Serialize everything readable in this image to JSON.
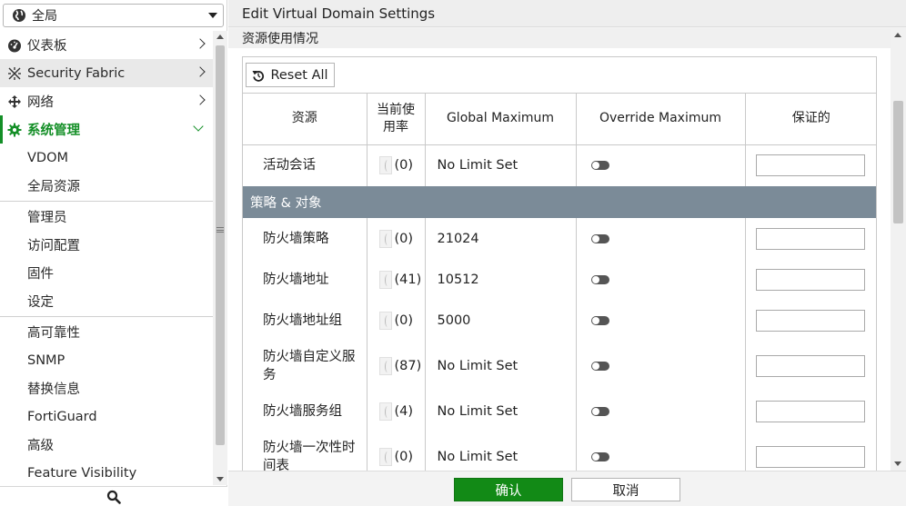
{
  "vdom_selector": {
    "value": "全局",
    "icon": "globe-icon"
  },
  "nav": {
    "dashboard": {
      "label": "仪表板",
      "icon": "dashboard-icon"
    },
    "security_fabric": {
      "label": "Security Fabric",
      "icon": "fabric-icon"
    },
    "network": {
      "label": "网络",
      "icon": "network-icon"
    },
    "system": {
      "label": "系统管理",
      "icon": "gear-icon"
    },
    "system_items": [
      "VDOM",
      "全局资源",
      "管理员",
      "访问配置",
      "固件",
      "设定",
      "高可靠性",
      "SNMP",
      "替换信息",
      "FortiGuard",
      "高级",
      "Feature Visibility"
    ]
  },
  "main": {
    "title": "Edit Virtual Domain Settings",
    "section": "资源使用情况",
    "reset_label": "Reset All",
    "columns": [
      "资源",
      "当前使用率",
      "Global Maximum",
      "Override Maximum",
      "保证的"
    ],
    "rows_top": [
      {
        "name": "活动会话",
        "usage": "(0)",
        "gmax": "No Limit Set"
      }
    ],
    "group_label": "策略 & 对象",
    "rows_group": [
      {
        "name": "防火墙策略",
        "usage": "(0)",
        "gmax": "21024"
      },
      {
        "name": "防火墙地址",
        "usage": "(41)",
        "gmax": "10512"
      },
      {
        "name": "防火墙地址组",
        "usage": "(0)",
        "gmax": "5000"
      },
      {
        "name": "防火墙自定义服务",
        "usage": "(87)",
        "gmax": "No Limit Set"
      },
      {
        "name": "防火墙服务组",
        "usage": "(4)",
        "gmax": "No Limit Set"
      },
      {
        "name": "防火墙一次性时间表",
        "usage": "(0)",
        "gmax": "No Limit Set"
      }
    ]
  },
  "footer": {
    "ok_label": "确认",
    "cancel_label": "取消"
  },
  "colors": {
    "accent_green": "#148f27",
    "ok_button": "#128a16",
    "group_header": "#7b8b98"
  }
}
